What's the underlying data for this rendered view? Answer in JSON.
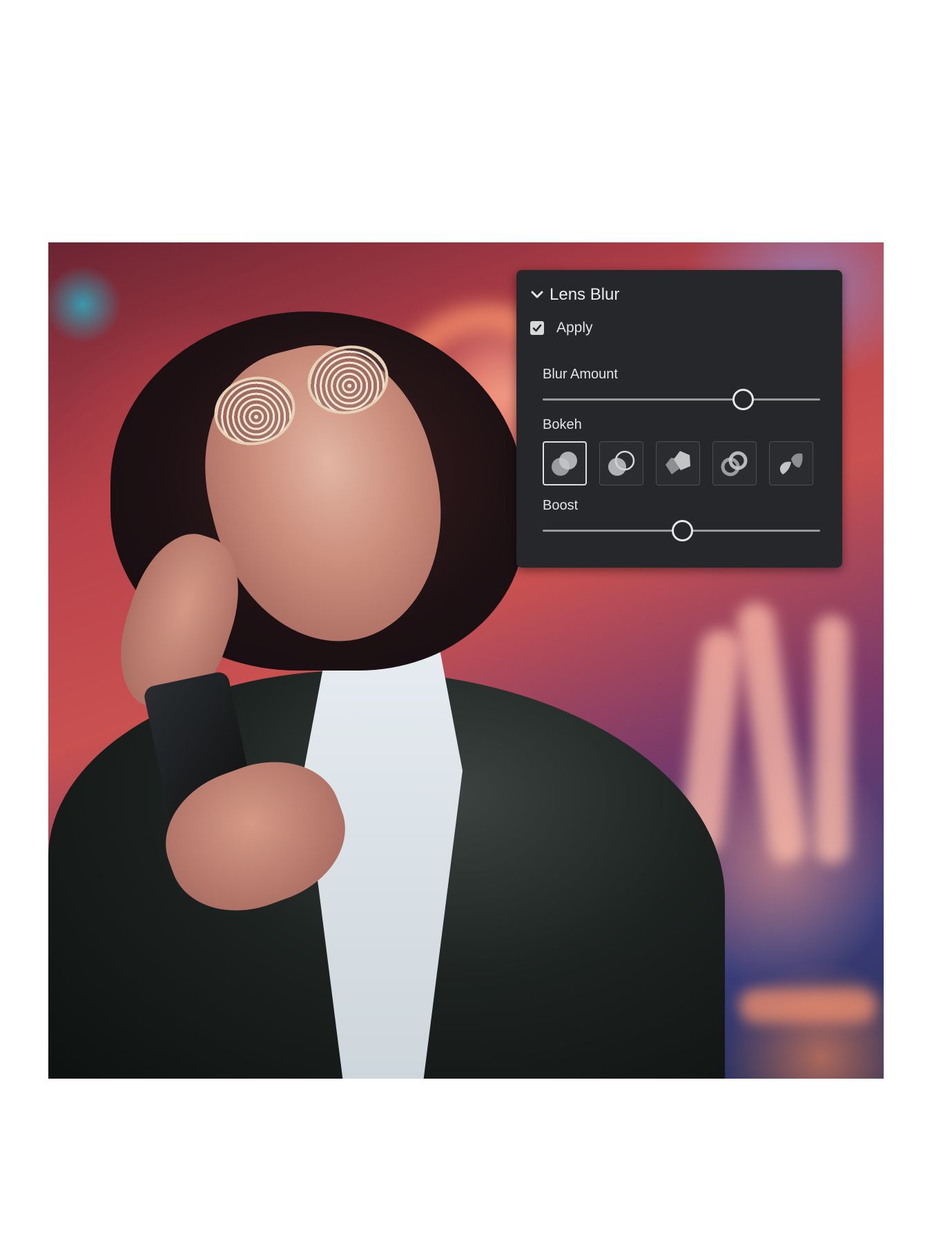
{
  "lens_blur_panel": {
    "title": "Lens Blur",
    "apply_label": "Apply",
    "apply_checked": true,
    "blur_amount": {
      "label": "Blur Amount",
      "value_fraction": 0.72
    },
    "bokeh": {
      "label": "Bokeh",
      "selected_index": 0,
      "options": [
        "circle-bokeh-icon",
        "bubble-bokeh-icon",
        "blade-bokeh-icon",
        "ring-bokeh-icon",
        "cat-eye-bokeh-icon"
      ]
    },
    "boost": {
      "label": "Boost",
      "value_fraction": 0.5
    }
  },
  "colors": {
    "panel_bg": "#26272a",
    "text": "#e4e4e4",
    "track": "#9a9a9a",
    "thumb_border": "#e8e8e8"
  }
}
